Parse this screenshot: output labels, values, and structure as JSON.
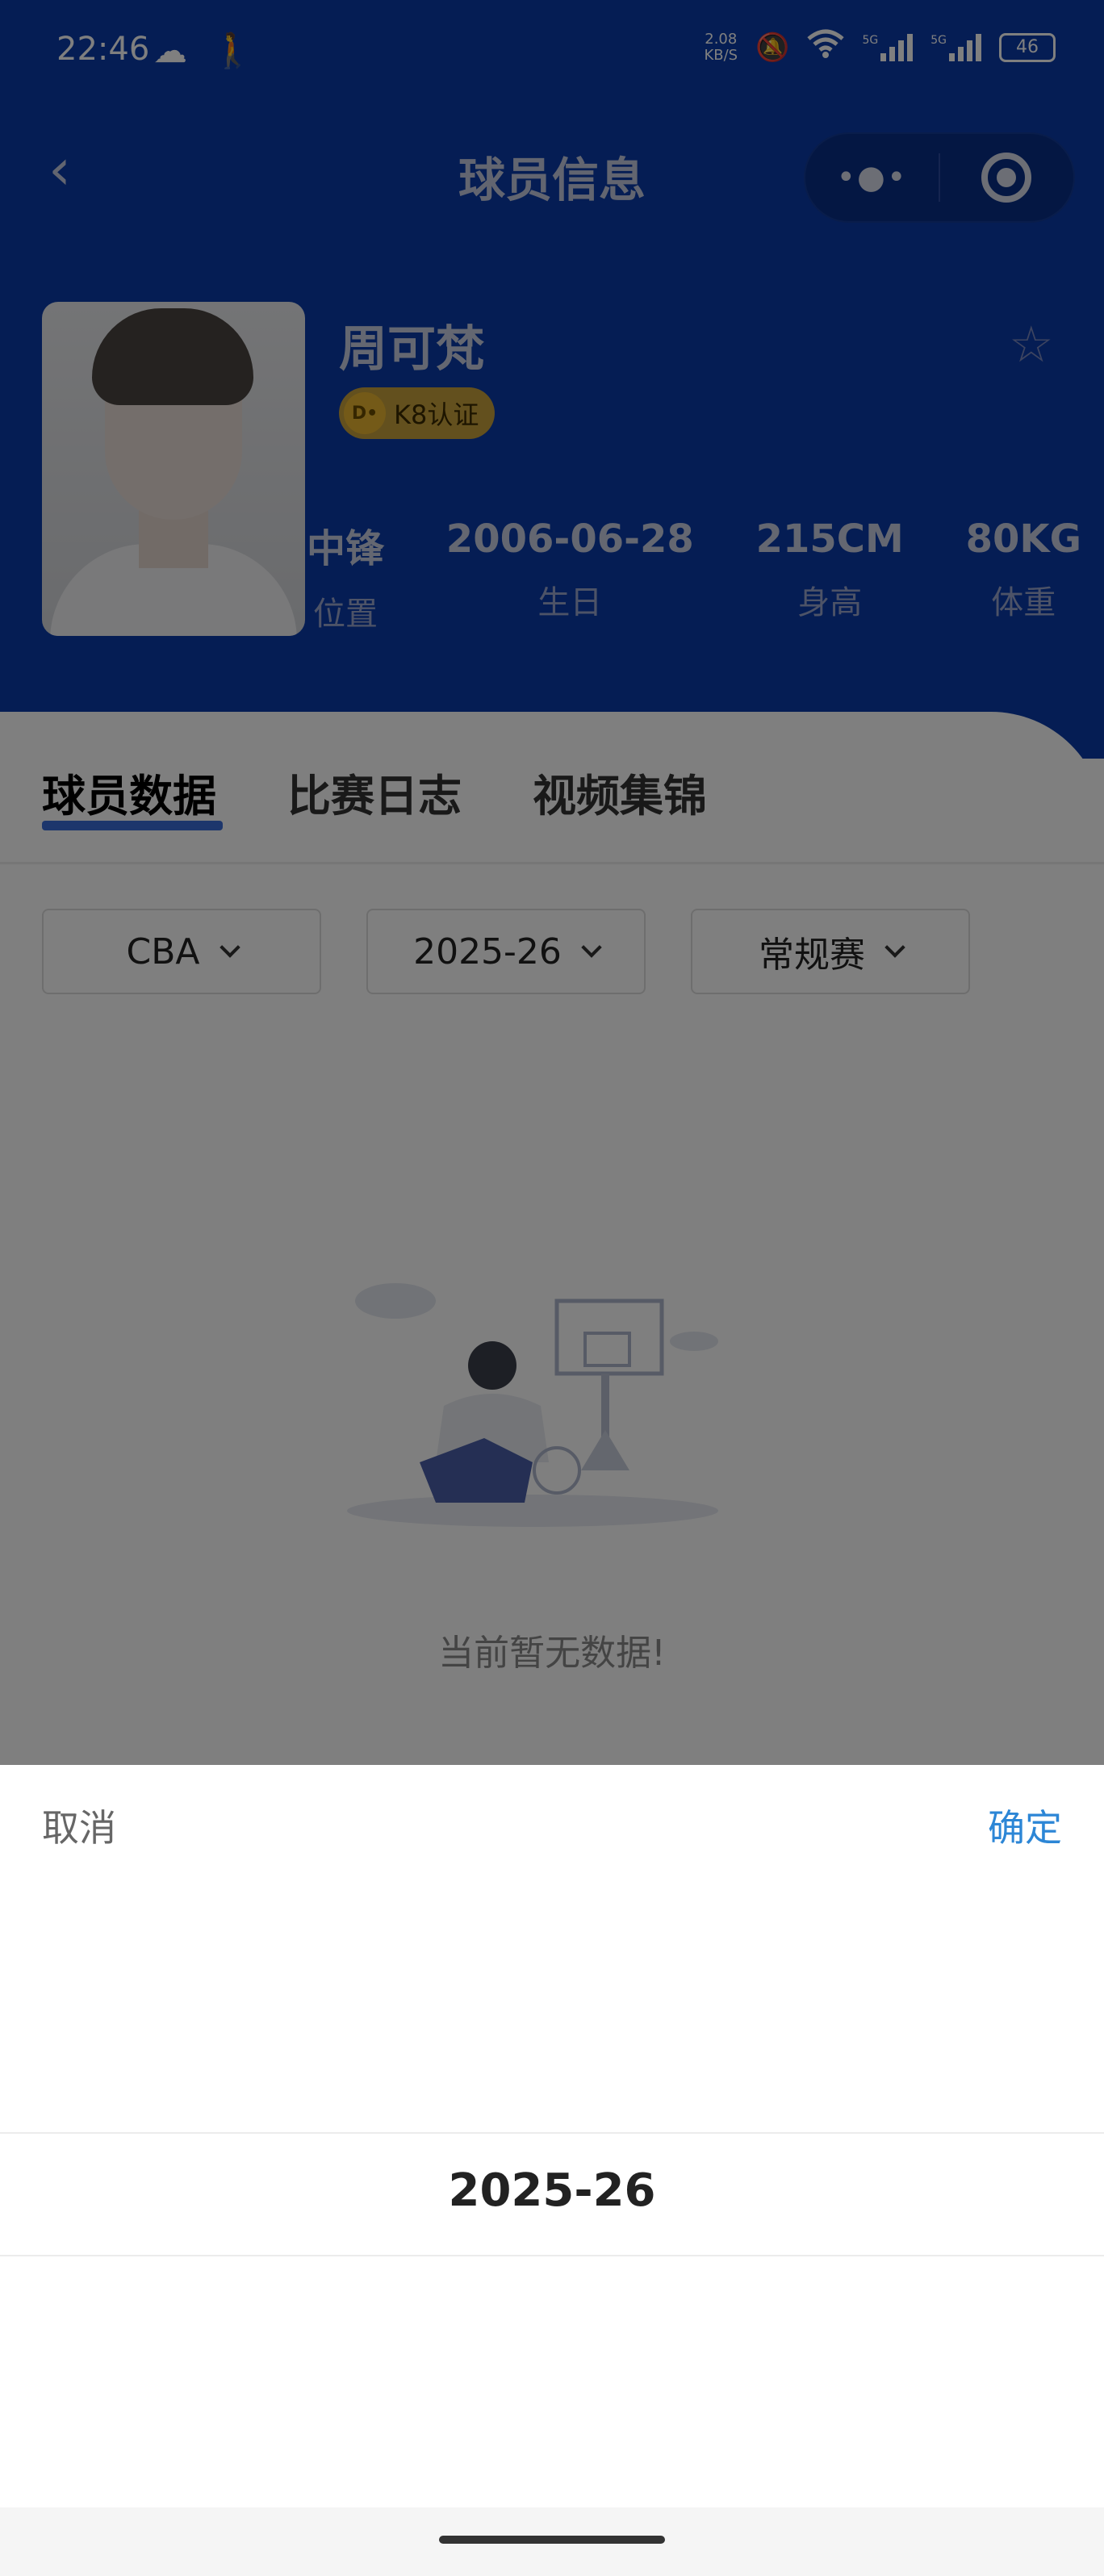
{
  "status_bar": {
    "time": "22:46",
    "speed_value": "2.08",
    "speed_unit": "KB/S",
    "network_1": "5G",
    "network_2": "5G",
    "battery": "46",
    "icons": [
      "cloud-icon",
      "walking-icon",
      "mute-bell-icon",
      "wifi-icon",
      "signal-icon",
      "battery-icon"
    ]
  },
  "nav": {
    "title": "球员信息",
    "back_icon": "chevron-left-icon",
    "more_icon": "more-dots-icon",
    "target_icon": "target-icon"
  },
  "player": {
    "name": "周可梵",
    "badge": "K8认证",
    "badge_icon_text": "D•",
    "stats": [
      {
        "value": "中锋",
        "label": "位置"
      },
      {
        "value": "2006-06-28",
        "label": "生日"
      },
      {
        "value": "215CM",
        "label": "身高"
      },
      {
        "value": "80KG",
        "label": "体重"
      }
    ]
  },
  "tabs": [
    {
      "label": "球员数据",
      "active": true
    },
    {
      "label": "比赛日志",
      "active": false
    },
    {
      "label": "视频集锦",
      "active": false
    }
  ],
  "filters": [
    {
      "value": "CBA"
    },
    {
      "value": "2025-26"
    },
    {
      "value": "常规赛"
    }
  ],
  "empty_state": {
    "message": "当前暂无数据!"
  },
  "picker": {
    "cancel": "取消",
    "confirm": "确定",
    "selected": "2025-26"
  },
  "colors": {
    "header_bg": "#0a3aa8",
    "accent": "#2c86d6",
    "tab_underline": "#3a6dd8"
  }
}
